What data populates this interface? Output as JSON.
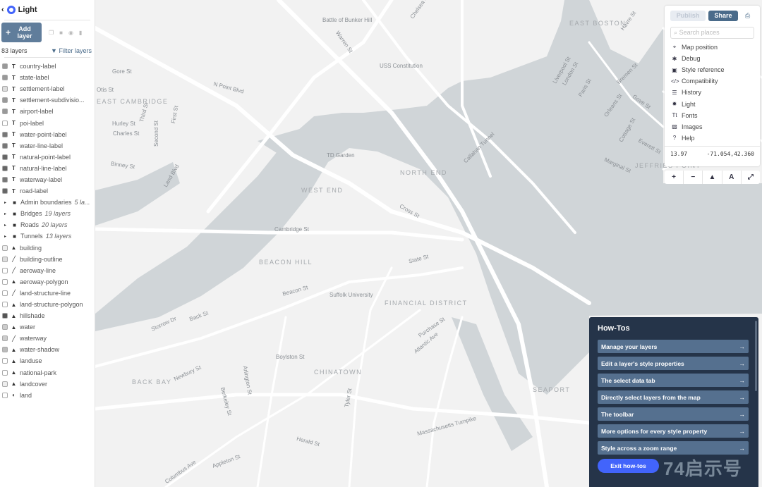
{
  "header": {
    "back": "‹",
    "title": "Light"
  },
  "toolbar": {
    "add_layer": "Add layer",
    "plus": "+",
    "count": "83 layers",
    "filter": "Filter layers"
  },
  "layers": [
    {
      "name": "country-label",
      "type": "T",
      "sw": "#999"
    },
    {
      "name": "state-label",
      "type": "T",
      "sw": "#999"
    },
    {
      "name": "settlement-label",
      "type": "T",
      "sw": "#ddd"
    },
    {
      "name": "settlement-subdivisio...",
      "type": "T",
      "sw": "#999"
    },
    {
      "name": "airport-label",
      "type": "T",
      "sw": "#999"
    },
    {
      "name": "poi-label",
      "type": "T",
      "sw": "#fff"
    },
    {
      "name": "water-point-label",
      "type": "T",
      "sw": "#777"
    },
    {
      "name": "water-line-label",
      "type": "T",
      "sw": "#777"
    },
    {
      "name": "natural-point-label",
      "type": "T",
      "sw": "#666"
    },
    {
      "name": "natural-line-label",
      "type": "T",
      "sw": "#666"
    },
    {
      "name": "waterway-label",
      "type": "T",
      "sw": "#777"
    },
    {
      "name": "road-label",
      "type": "T",
      "sw": "#666"
    },
    {
      "name": "Admin boundaries",
      "type": "folder",
      "count": "5 la..."
    },
    {
      "name": "Bridges",
      "type": "folder",
      "count": "19 layers"
    },
    {
      "name": "Roads",
      "type": "folder",
      "count": "20 layers"
    },
    {
      "name": "Tunnels",
      "type": "folder",
      "count": "13 layers"
    },
    {
      "name": "building",
      "type": "fill",
      "sw": "#eee"
    },
    {
      "name": "building-outline",
      "type": "line",
      "sw": "#ddd"
    },
    {
      "name": "aeroway-line",
      "type": "line",
      "sw": "#fff"
    },
    {
      "name": "aeroway-polygon",
      "type": "fill",
      "sw": "#fff"
    },
    {
      "name": "land-structure-line",
      "type": "line",
      "sw": "#fff"
    },
    {
      "name": "land-structure-polygon",
      "type": "fill",
      "sw": "#fff"
    },
    {
      "name": "hillshade",
      "type": "fill",
      "sw": "#555"
    },
    {
      "name": "water",
      "type": "fill",
      "sw": "#ccc"
    },
    {
      "name": "waterway",
      "type": "line",
      "sw": "#ccc"
    },
    {
      "name": "water-shadow",
      "type": "fill",
      "sw": "#bbb"
    },
    {
      "name": "landuse",
      "type": "fill",
      "sw": "#fff"
    },
    {
      "name": "national-park",
      "type": "fill",
      "sw": "#fff"
    },
    {
      "name": "landcover",
      "type": "fill",
      "sw": "#eee"
    },
    {
      "name": "land",
      "type": "bg",
      "sw": "#fff"
    }
  ],
  "panel": {
    "publish": "Publish",
    "share": "Share",
    "search_placeholder": "Search places",
    "menu": [
      {
        "label": "Map position",
        "icon": "crosshair-icon",
        "glyph": "⌖"
      },
      {
        "label": "Debug",
        "icon": "bug-icon",
        "glyph": "✱"
      },
      {
        "label": "Style reference",
        "icon": "book-icon",
        "glyph": "▣"
      },
      {
        "label": "Compatibility",
        "icon": "code-icon",
        "glyph": "</>"
      },
      {
        "label": "History",
        "icon": "history-icon",
        "glyph": "☰"
      },
      {
        "label": "Light",
        "icon": "sun-icon",
        "glyph": "✹"
      },
      {
        "label": "Fonts",
        "icon": "fonts-icon",
        "glyph": "Tt"
      },
      {
        "label": "Images",
        "icon": "image-icon",
        "glyph": "▨"
      },
      {
        "label": "Help",
        "icon": "help-icon",
        "glyph": "?"
      }
    ],
    "zoom": "13.97",
    "coords": "-71.054,42.360"
  },
  "controls": [
    "+",
    "−",
    "▲",
    "A",
    "⤢"
  ],
  "howtos": {
    "title": "How-Tos",
    "items": [
      "Manage your layers",
      "Edit a layer's style properties",
      "The select data tab",
      "Directly select layers from the map",
      "The toolbar",
      "More options for every style property",
      "Style across a zoom range"
    ],
    "arrow": "→",
    "exit": "Exit how-tos"
  },
  "map": {
    "colors": {
      "land": "#f2f2f2",
      "water": "#d0d5d8",
      "road": "#ffffff"
    },
    "labels": [
      "Battle of Bunker Hill",
      "Warren St",
      "USS Constitution",
      "Gore St",
      "Otis St",
      "N Point Blvd",
      "EAST CAMBRIDGE",
      "Hurley St",
      "Charles St",
      "Third St",
      "Second St",
      "First St",
      "Binney St",
      "Land Blvd",
      "TD Garden",
      "NORTH END",
      "WEST END",
      "Cross St",
      "Cambridge St",
      "BEACON HILL",
      "State St",
      "Beacon St",
      "Suffolk University",
      "FINANCIAL DISTRICT",
      "Storrow Dr",
      "Back St",
      "Boylston St",
      "CHINATOWN",
      "BACK BAY",
      "Newbury St",
      "Arlington St",
      "Berkeley St",
      "Tyler St",
      "Purchase St",
      "Atlantic Ave",
      "Massachusetts Turnpike",
      "Herald St",
      "Appleton St",
      "Columbus Ave",
      "SEAPORT",
      "EAST BOSTON",
      "Havre St",
      "Liverpool St",
      "London St",
      "Paris St",
      "Bremen St",
      "Orleans St",
      "Gove St",
      "Cottage St",
      "Everett St",
      "Marginal St",
      "JEFFRIES POINT",
      "Callahan Tunnel",
      "Chelsea St"
    ]
  },
  "watermark": "74启示号"
}
